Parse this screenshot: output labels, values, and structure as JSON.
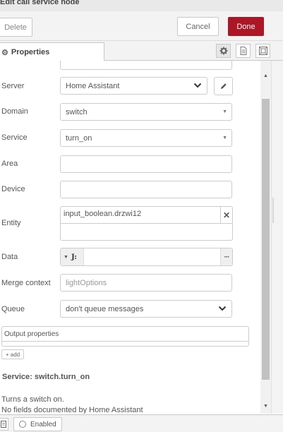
{
  "titlebar": {
    "title": "Edit call service node"
  },
  "actions": {
    "delete_label": "Delete",
    "cancel_label": "Cancel",
    "done_label": "Done"
  },
  "tabs": {
    "properties_label": "Properties",
    "icons": [
      "gear-icon",
      "description-icon",
      "appearance-icon"
    ]
  },
  "form": {
    "server": {
      "label": "Server",
      "value": "Home Assistant"
    },
    "domain": {
      "label": "Domain",
      "value": "switch"
    },
    "service": {
      "label": "Service",
      "value": "turn_on"
    },
    "area": {
      "label": "Area",
      "value": ""
    },
    "device": {
      "label": "Device",
      "value": ""
    },
    "entity": {
      "label": "Entity",
      "tag": "input_boolean.drzwi12"
    },
    "data": {
      "label": "Data",
      "type_icon": "J:",
      "expand_icon": "···",
      "value": ""
    },
    "merge_context": {
      "label": "Merge context",
      "placeholder": "lightOptions"
    },
    "queue": {
      "label": "Queue",
      "value": "don't queue messages"
    }
  },
  "output": {
    "label": "Output properties",
    "add_label": "+ add"
  },
  "service_info": {
    "title": "Service: switch.turn_on",
    "description": "Turns a switch on.",
    "fields_note": "No fields documented by Home Assistant"
  },
  "footer": {
    "enabled_label": "Enabled"
  },
  "colors": {
    "done": "#ad1625",
    "toolbar": "#f3f3f3",
    "border": "#cccccc"
  }
}
